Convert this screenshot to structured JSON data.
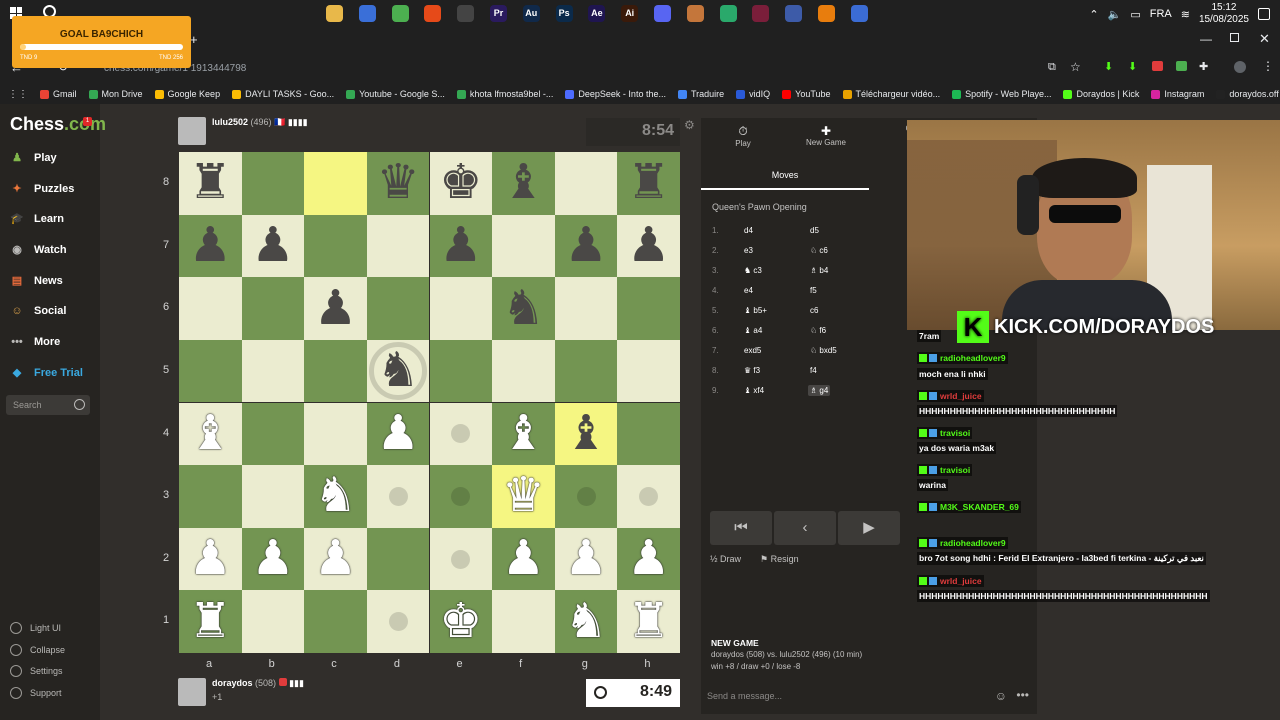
{
  "taskbar": {
    "tray": {
      "lang": "FRA",
      "time": "15:12",
      "date": "15/08/2025"
    },
    "apps": [
      {
        "name": "file-explorer-icon",
        "color": "#e8b84a",
        "glyph": ""
      },
      {
        "name": "store-icon",
        "color": "#3a6fd8",
        "glyph": ""
      },
      {
        "name": "chrome-icon",
        "color": "#4caf50",
        "glyph": ""
      },
      {
        "name": "brave-icon",
        "color": "#e64a19",
        "glyph": ""
      },
      {
        "name": "obs-icon",
        "color": "#444444",
        "glyph": ""
      },
      {
        "name": "premiere-icon",
        "color": "#2a1a5e",
        "glyph": "Pr"
      },
      {
        "name": "audition-icon",
        "color": "#10294a",
        "glyph": "Au"
      },
      {
        "name": "photoshop-icon",
        "color": "#0b2a4a",
        "glyph": "Ps"
      },
      {
        "name": "after-effects-icon",
        "color": "#1f1550",
        "glyph": "Ae"
      },
      {
        "name": "illustrator-icon",
        "color": "#3a1a0a",
        "glyph": "Ai"
      },
      {
        "name": "discord-icon",
        "color": "#5865f2",
        "glyph": ""
      },
      {
        "name": "app-icon",
        "color": "#c4763b",
        "glyph": ""
      },
      {
        "name": "chrome-alt-icon",
        "color": "#2aa96b",
        "glyph": ""
      },
      {
        "name": "vegas-icon",
        "color": "#7a1e3a",
        "glyph": ""
      },
      {
        "name": "tool-icon",
        "color": "#3d5ba8",
        "glyph": ""
      },
      {
        "name": "blender-icon",
        "color": "#e87d0d",
        "glyph": ""
      },
      {
        "name": "shield-app-icon",
        "color": "#3b6cd4",
        "glyph": ""
      }
    ]
  },
  "goal": {
    "title": "GOAL BA9CHICH",
    "low": "TND 9",
    "high": "TND 256",
    "progress": 0.035
  },
  "browser": {
    "url": "chess.com/game/1 1913444798",
    "bookmarks": [
      {
        "label": "Gmail",
        "color": "#ea4335"
      },
      {
        "label": "Mon Drive",
        "color": "#34a853"
      },
      {
        "label": "Google Keep",
        "color": "#fbbc04"
      },
      {
        "label": "DAYLI TASKS - Goo...",
        "color": "#fbbc04"
      },
      {
        "label": "Youtube - Google S...",
        "color": "#34a853"
      },
      {
        "label": "khota lfmosta9bel -...",
        "color": "#34a853"
      },
      {
        "label": "DeepSeek - Into the...",
        "color": "#4d6bfe"
      },
      {
        "label": "Traduire",
        "color": "#4285f4"
      },
      {
        "label": "vidIQ",
        "color": "#2a5ad8"
      },
      {
        "label": "YouTube",
        "color": "#ff0000"
      },
      {
        "label": "Téléchargeur vidéo...",
        "color": "#e8a200"
      },
      {
        "label": "Spotify - Web Playe...",
        "color": "#1db954"
      },
      {
        "label": "Doraydos | Kick",
        "color": "#53fc18"
      },
      {
        "label": "Instagram",
        "color": "#d6249f"
      },
      {
        "label": "doraydos.off (@dor...",
        "color": "#222222"
      }
    ]
  },
  "sidebar": {
    "logo_a": "Chess",
    "logo_b": ".com",
    "logo_badge": "1",
    "nav": [
      {
        "label": "Play",
        "color": "#81b64c",
        "glyph": "♟"
      },
      {
        "label": "Puzzles",
        "color": "#e8763b",
        "glyph": "✦"
      },
      {
        "label": "Learn",
        "color": "#3a9bd5",
        "glyph": "🎓"
      },
      {
        "label": "Watch",
        "color": "#bab9b7",
        "glyph": "◉"
      },
      {
        "label": "News",
        "color": "#e66a3b",
        "glyph": "▤"
      },
      {
        "label": "Social",
        "color": "#d9a14b",
        "glyph": "☺"
      },
      {
        "label": "More",
        "color": "#bab9b7",
        "glyph": "•••"
      },
      {
        "label": "Free Trial",
        "color": "#3aa9e0",
        "glyph": "◆"
      }
    ],
    "search_placeholder": "Search",
    "footer": [
      "Light UI",
      "Collapse",
      "Settings",
      "Support"
    ]
  },
  "game": {
    "top_player": {
      "name": "lulu2502",
      "rating": "(496)",
      "flag": "🇫🇷",
      "clock": "8:54"
    },
    "bottom_player": {
      "name": "doraydos",
      "rating": "(508)",
      "extra": "+1",
      "clock": "8:49"
    },
    "ranks": [
      "8",
      "7",
      "6",
      "5",
      "4",
      "3",
      "2",
      "1"
    ],
    "files": [
      "a",
      "b",
      "c",
      "d",
      "e",
      "f",
      "g",
      "h"
    ],
    "light_color": "#ebecd0",
    "dark_color": "#739552",
    "highlight_color": "#f5f682",
    "highlights": [
      "c8",
      "g4",
      "f3"
    ],
    "pieces": {
      "a8": "br",
      "d8": "bq",
      "e8": "bk",
      "f8": "bb",
      "h8": "br",
      "a7": "bp",
      "b7": "bp",
      "e7": "bp",
      "g7": "bp",
      "h7": "bp",
      "c6": "bp",
      "f6": "bn",
      "d5": "bn",
      "a4": "wb",
      "d4": "wp",
      "f4": "wb",
      "g4": "bb",
      "c3": "wn",
      "f3": "wq",
      "a2": "wp",
      "b2": "wp",
      "c2": "wp",
      "f2": "wp",
      "g2": "wp",
      "h2": "wp",
      "a1": "wr",
      "e1": "wk",
      "g1": "wn",
      "h1": "wr"
    },
    "dots": [
      "e4",
      "d3",
      "e3",
      "g3",
      "h3",
      "e2",
      "d1"
    ],
    "rings": [
      "d5"
    ]
  },
  "panel": {
    "tabs": [
      {
        "label": "Play",
        "glyph": "⏱"
      },
      {
        "label": "New Game",
        "glyph": "✚"
      },
      {
        "label": "Ga",
        "glyph": ""
      }
    ],
    "moves_tab": "Moves",
    "opening": "Queen's Pawn Opening",
    "moves": [
      {
        "n": "1.",
        "w": "d4",
        "b": "d5"
      },
      {
        "n": "2.",
        "w": "e3",
        "b": "♘ c6"
      },
      {
        "n": "3.",
        "w": "♞ c3",
        "b": "♗ b4"
      },
      {
        "n": "4.",
        "w": "e4",
        "b": "f5"
      },
      {
        "n": "5.",
        "w": "♝ b5+",
        "b": "c6"
      },
      {
        "n": "6.",
        "w": "♝ a4",
        "b": "♘ f6"
      },
      {
        "n": "7.",
        "w": "exd5",
        "b": "♘ bxd5"
      },
      {
        "n": "8.",
        "w": "♛ f3",
        "b": "f4"
      },
      {
        "n": "9.",
        "w": "♝ xf4",
        "b": "♗ g4"
      }
    ],
    "controls": [
      "⏮",
      "‹",
      "▶",
      "›",
      "⏭"
    ],
    "draw": "½ Draw",
    "resign": "⚑ Resign",
    "newgame_title": "NEW GAME",
    "newgame_line1": "doraydos (508) vs. lulu2502 (496) (10 min)",
    "newgame_line2": "win +8 / draw +0 / lose -8",
    "send_placeholder": "Send a message..."
  },
  "stream": {
    "kick_url": "KICK.COM/DORAYDOS",
    "kick_logo": "K",
    "chat": [
      {
        "type": "text",
        "text": "7ram"
      },
      {
        "type": "user",
        "user": "radioheadlover9",
        "color": "#53fc18"
      },
      {
        "type": "text",
        "text": "moch ena li nhki"
      },
      {
        "type": "user",
        "user": "wrld_juice",
        "color": "#e03c3c"
      },
      {
        "type": "text",
        "text": "HHHHHHHHHHHHHHHHHHHHHHHHHHHHHHHH"
      },
      {
        "type": "user",
        "user": "travisoi",
        "color": "#53fc18"
      },
      {
        "type": "text",
        "text": "ya dos waria m3ak"
      },
      {
        "type": "user",
        "user": "travisoi",
        "color": "#53fc18"
      },
      {
        "type": "text",
        "text": "warina"
      },
      {
        "type": "user",
        "user": "M3K_SKANDER_69",
        "color": "#53fc18"
      },
      {
        "type": "user",
        "user": "radioheadlover9",
        "color": "#53fc18"
      },
      {
        "type": "text",
        "text": "bro 7ot song hdhi : Ferid El Extranjero - la3bed fi terkina - نعبد في تركينة"
      },
      {
        "type": "user",
        "user": "wrld_juice",
        "color": "#e03c3c"
      },
      {
        "type": "text",
        "text": "HHHHHHHHHHHHHHHHHHHHHHHHHHHHHHHHHHHHHHHHHHHHHHH"
      }
    ]
  }
}
